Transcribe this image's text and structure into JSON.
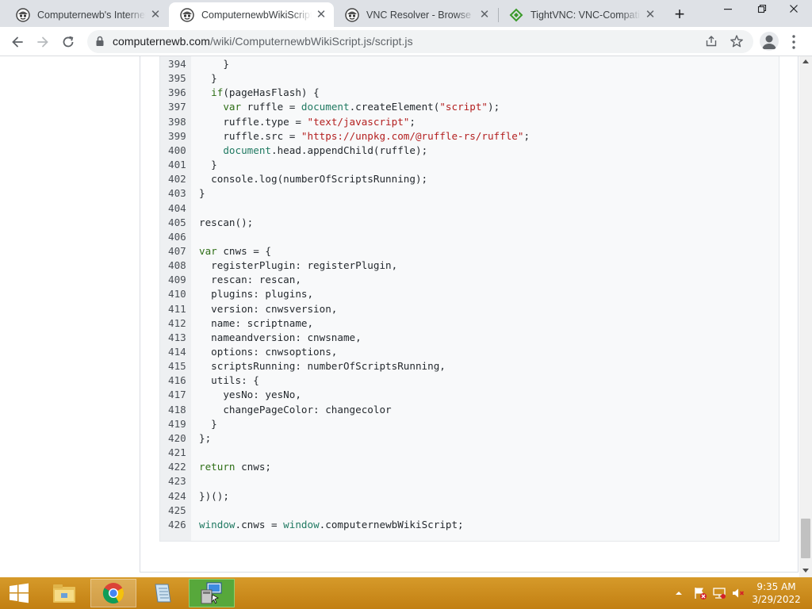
{
  "window": {
    "tabs": [
      {
        "title": "Computernewb's Internet Pi",
        "active": false
      },
      {
        "title": "ComputernewbWikiScript.js",
        "active": true
      },
      {
        "title": "VNC Resolver - Browse",
        "active": false
      },
      {
        "title": "TightVNC: VNC-Compatible",
        "active": false
      }
    ],
    "new_tab_label": "+",
    "close_glyph": "✕"
  },
  "toolbar": {
    "url_host": "computernewb.com",
    "url_path": "/wiki/ComputernewbWikiScript.js/script.js"
  },
  "code_lines": [
    {
      "n": "394",
      "html": "      }"
    },
    {
      "n": "395",
      "html": "    }"
    },
    {
      "n": "396",
      "html": "    <span class=\"kw\">if</span>(pageHasFlash) {"
    },
    {
      "n": "397",
      "html": "      <span class=\"kw\">var</span> ruffle = <span class=\"obj\">document</span>.createElement(<span class=\"str\">\"script\"</span>);"
    },
    {
      "n": "398",
      "html": "      ruffle.type = <span class=\"str\">\"text/javascript\"</span>;"
    },
    {
      "n": "399",
      "html": "      ruffle.src = <span class=\"str\">\"https://unpkg.com/@ruffle-rs/ruffle\"</span>;"
    },
    {
      "n": "400",
      "html": "      <span class=\"obj\">document</span>.head.appendChild(ruffle);"
    },
    {
      "n": "401",
      "html": "    }"
    },
    {
      "n": "402",
      "html": "    console.log(numberOfScriptsRunning);"
    },
    {
      "n": "403",
      "html": "  }"
    },
    {
      "n": "404",
      "html": ""
    },
    {
      "n": "405",
      "html": "  rescan();"
    },
    {
      "n": "406",
      "html": ""
    },
    {
      "n": "407",
      "html": "  <span class=\"kw\">var</span> cnws = {"
    },
    {
      "n": "408",
      "html": "    registerPlugin: registerPlugin,"
    },
    {
      "n": "409",
      "html": "    rescan: rescan,"
    },
    {
      "n": "410",
      "html": "    plugins: plugins,"
    },
    {
      "n": "411",
      "html": "    version: cnwsversion,"
    },
    {
      "n": "412",
      "html": "    name: scriptname,"
    },
    {
      "n": "413",
      "html": "    nameandversion: cnwsname,"
    },
    {
      "n": "414",
      "html": "    options: cnwsoptions,"
    },
    {
      "n": "415",
      "html": "    scriptsRunning: numberOfScriptsRunning,"
    },
    {
      "n": "416",
      "html": "    utils: {"
    },
    {
      "n": "417",
      "html": "      yesNo: yesNo,"
    },
    {
      "n": "418",
      "html": "      changePageColor: changecolor"
    },
    {
      "n": "419",
      "html": "    }"
    },
    {
      "n": "420",
      "html": "  };"
    },
    {
      "n": "421",
      "html": ""
    },
    {
      "n": "422",
      "html": "  <span class=\"kw\">return</span> cnws;"
    },
    {
      "n": "423",
      "html": ""
    },
    {
      "n": "424",
      "html": "  })();"
    },
    {
      "n": "425",
      "html": ""
    },
    {
      "n": "426",
      "html": "  <span class=\"obj\">window</span>.cnws = <span class=\"obj\">window</span>.computernewbWikiScript;"
    }
  ],
  "taskbar": {
    "clock_time": "9:35 AM",
    "clock_date": "3/29/2022",
    "apps": [
      "chrome-icon",
      "file-explorer-icon",
      "notepad-icon",
      "vnc-viewer-icon"
    ]
  },
  "colors": {
    "keyword": "#2e6e16",
    "string": "#b31f1f",
    "object": "#217a62",
    "taskbar": "#cc8b1f"
  }
}
